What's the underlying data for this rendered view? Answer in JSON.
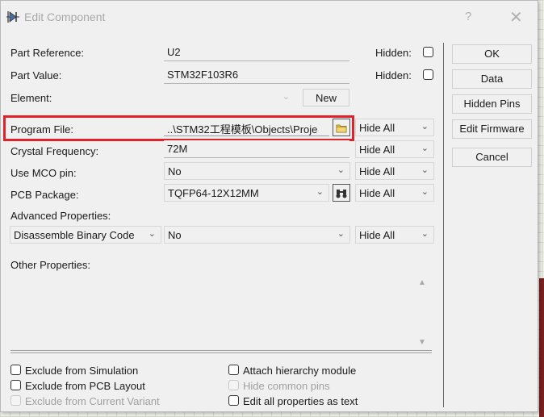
{
  "dialog": {
    "title": "Edit Component",
    "help": "?",
    "close": "✕"
  },
  "fields": {
    "part_reference": {
      "label": "Part Reference:",
      "value": "U2",
      "hidden_label": "Hidden:"
    },
    "part_value": {
      "label": "Part Value:",
      "value": "STM32F103R6",
      "hidden_label": "Hidden:"
    },
    "element": {
      "label": "Element:",
      "value": "",
      "new_button": "New"
    },
    "program_file": {
      "label": "Program File:",
      "value": "..\\STM32工程模板\\Objects\\Proje",
      "visibility": "Hide All"
    },
    "crystal_frequency": {
      "label": "Crystal Frequency:",
      "value": "72M",
      "visibility": "Hide All"
    },
    "use_mco_pin": {
      "label": "Use MCO pin:",
      "value": "No",
      "visibility": "Hide All"
    },
    "pcb_package": {
      "label": "PCB Package:",
      "value": "TQFP64-12X12MM",
      "visibility": "Hide All"
    },
    "advanced_properties": {
      "label": "Advanced Properties:",
      "property": "Disassemble Binary Code",
      "value": "No",
      "visibility": "Hide All"
    },
    "other_properties": {
      "label": "Other Properties:",
      "value": ""
    }
  },
  "checkboxes": {
    "exclude_simulation": {
      "label": "Exclude from Simulation",
      "checked": false,
      "enabled": true
    },
    "exclude_pcb": {
      "label": "Exclude from PCB Layout",
      "checked": false,
      "enabled": true
    },
    "exclude_variant": {
      "label": "Exclude from Current Variant",
      "checked": false,
      "enabled": false
    },
    "attach_hierarchy": {
      "label": "Attach hierarchy module",
      "checked": false,
      "enabled": true
    },
    "hide_common_pins": {
      "label": "Hide common pins",
      "checked": false,
      "enabled": false
    },
    "edit_all_text": {
      "label": "Edit all properties as text",
      "checked": false,
      "enabled": true
    }
  },
  "buttons": {
    "ok": "OK",
    "data": "Data",
    "hidden_pins": "Hidden Pins",
    "edit_firmware": "Edit Firmware",
    "cancel": "Cancel"
  },
  "colors": {
    "highlight": "#e0222a",
    "dialog_bg": "#f0f0f0"
  }
}
